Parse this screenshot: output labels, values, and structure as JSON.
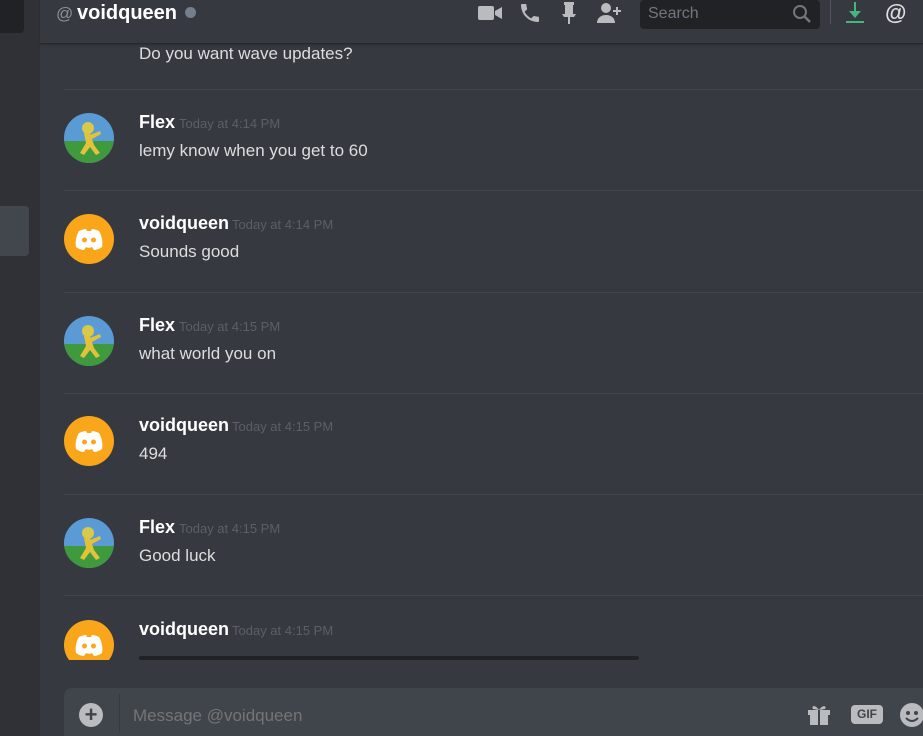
{
  "header": {
    "at_symbol": "@",
    "title": "voidqueen",
    "status": "offline",
    "search_placeholder": "Search",
    "icons": [
      "video-icon",
      "phone-icon",
      "pin-icon",
      "add-friend-icon",
      "search-icon",
      "download-icon",
      "mention-icon"
    ]
  },
  "messages": {
    "continuation_text": "Do you want wave updates?",
    "groups": [
      {
        "author": "Flex",
        "timestamp": "Today at 4:14 PM",
        "text": "lemy know when you get to 60",
        "avatar": "flex-avatar"
      },
      {
        "author": "voidqueen",
        "timestamp": "Today at 4:14 PM",
        "text": "Sounds good",
        "avatar": "discord-default-avatar"
      },
      {
        "author": "Flex",
        "timestamp": "Today at 4:15 PM",
        "text": "what world you on",
        "avatar": "flex-avatar"
      },
      {
        "author": "voidqueen",
        "timestamp": "Today at 4:15 PM",
        "text": "494",
        "avatar": "discord-default-avatar"
      },
      {
        "author": "Flex",
        "timestamp": "Today at 4:15 PM",
        "text": "Good luck",
        "avatar": "flex-avatar"
      },
      {
        "author": "voidqueen",
        "timestamp": "Today at 4:15 PM",
        "text": "",
        "avatar": "discord-default-avatar"
      }
    ]
  },
  "composer": {
    "placeholder": "Message @voidqueen",
    "gif_label": "GIF",
    "icons": [
      "plus-icon",
      "gift-icon",
      "emoji-icon"
    ]
  },
  "colors": {
    "background": "#36393f",
    "sidebar": "#2f3136",
    "avatar_orange": "#faa61a",
    "download_green": "#43b581"
  }
}
